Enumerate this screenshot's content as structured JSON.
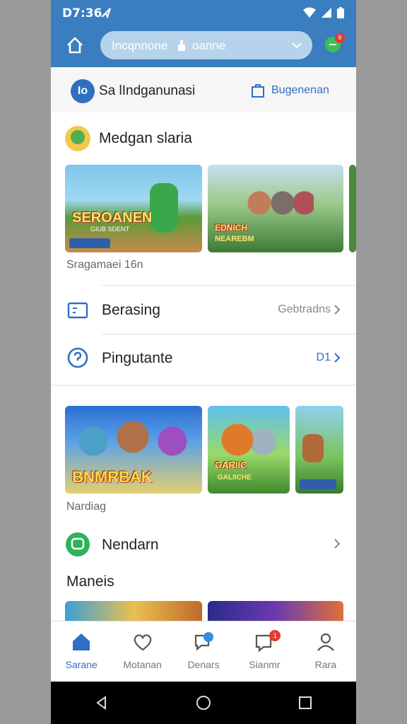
{
  "status": {
    "time": "D7:36"
  },
  "app_bar": {
    "search_placeholder": "Incqnnone",
    "search_query": "oanne",
    "chat_badge": "8"
  },
  "header": {
    "logo": "Io",
    "brand": "Sa lIndganunasi",
    "link_label": "Bugenenan"
  },
  "section1": {
    "title": "Medgan slaria",
    "cards": [
      {
        "art_text": "SEROANEN",
        "sub": "GIUB SDENT",
        "chip": ""
      },
      {
        "art_text": "EDNICH",
        "sub": "NEAREBM",
        "chip": ""
      }
    ],
    "caption": "Sragamaei 16n"
  },
  "rows": [
    {
      "icon": "card-icon",
      "label": "Berasing",
      "meta": "Gebtradns"
    },
    {
      "icon": "help-circle-icon",
      "label": "Pingutante",
      "meta": "D1"
    }
  ],
  "section2": {
    "cards": [
      {
        "art_text": "BNMRBAK",
        "top_tag": ""
      },
      {
        "art_text": "GARIIC",
        "sub": "GALIICHE"
      },
      {
        "art_text": "",
        "sub": ""
      }
    ],
    "caption": "Nardiag"
  },
  "row3": {
    "icon": "chat-bubble-icon",
    "label": "Nendarn"
  },
  "section3": {
    "title": "Maneis"
  },
  "bottom_nav": [
    {
      "label": "Sarane",
      "icon": "home-icon",
      "active": true
    },
    {
      "label": "Motanan",
      "icon": "heart-icon",
      "active": false
    },
    {
      "label": "Denars",
      "icon": "chat-icon",
      "active": false,
      "badge": ""
    },
    {
      "label": "Sianmr",
      "icon": "message-alert-icon",
      "active": false,
      "badge": "1"
    },
    {
      "label": "Rara",
      "icon": "user-icon",
      "active": false
    }
  ],
  "colors": {
    "primary": "#3a7ec0",
    "accent": "#2f6fc1",
    "badge": "#e53935"
  }
}
